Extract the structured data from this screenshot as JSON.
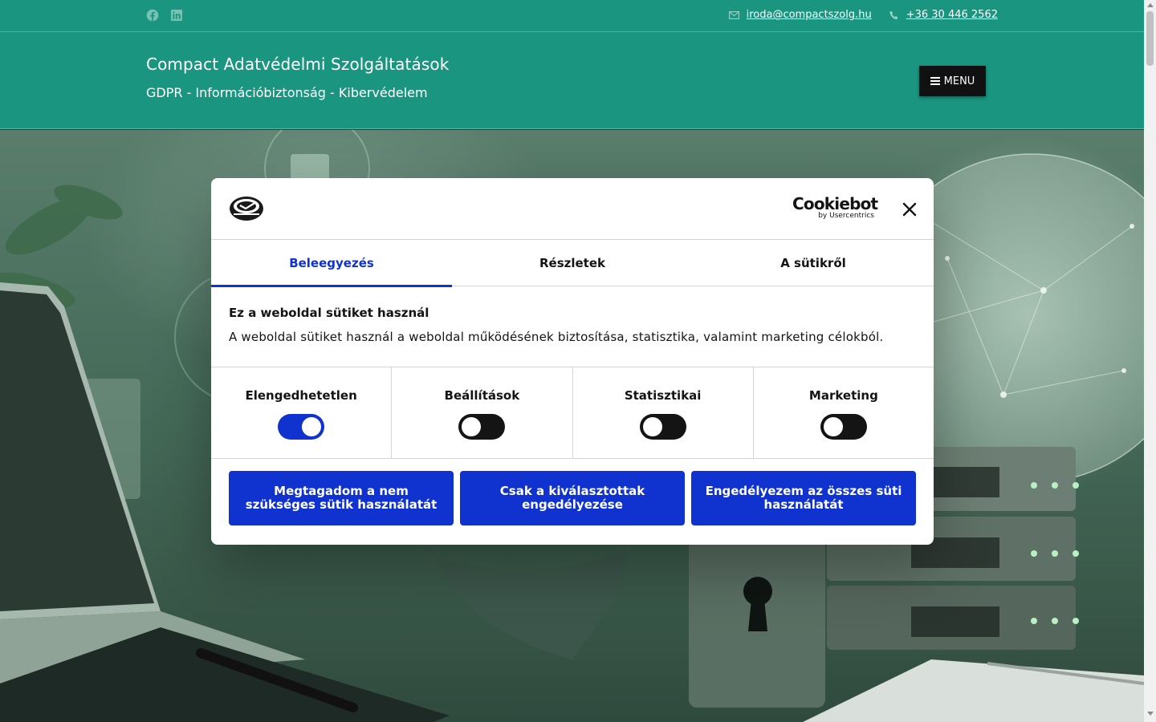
{
  "topbar": {
    "social_icons": [
      "facebook-icon",
      "linkedin-icon"
    ],
    "email": "iroda@compactszolg.hu",
    "phone": "+36 30 446 2562"
  },
  "header": {
    "title": "Compact Adatvédelmi Szolgáltatások",
    "tagline": "GDPR - Információbiztonság - Kibervédelem",
    "menu_label": "MENU"
  },
  "cookie_dialog": {
    "brand": "Cookiebot",
    "brand_sub": "by Usercentrics",
    "tabs": [
      {
        "label": "Beleegyezés",
        "active": true
      },
      {
        "label": "Részletek",
        "active": false
      },
      {
        "label": "A sütikről",
        "active": false
      }
    ],
    "heading": "Ez a weboldal sütiket használ",
    "description": "A weboldal sütiket használ a weboldal működésének biztosítása, statisztika, valamint marketing célokból.",
    "categories": [
      {
        "label": "Elengedhetetlen",
        "enabled": true
      },
      {
        "label": "Beállítások",
        "enabled": false
      },
      {
        "label": "Statisztikai",
        "enabled": false
      },
      {
        "label": "Marketing",
        "enabled": false
      }
    ],
    "buttons": {
      "deny": "Megtagadom a nem szükséges sütik használatát",
      "allow_selected": "Csak a kiválasztottak engedélyezése",
      "allow_all": "Engedélyezem az összes süti használatát"
    }
  },
  "colors": {
    "header_bg": "#1a9580",
    "accent": "#1032cf",
    "menu_bg": "#111111"
  }
}
